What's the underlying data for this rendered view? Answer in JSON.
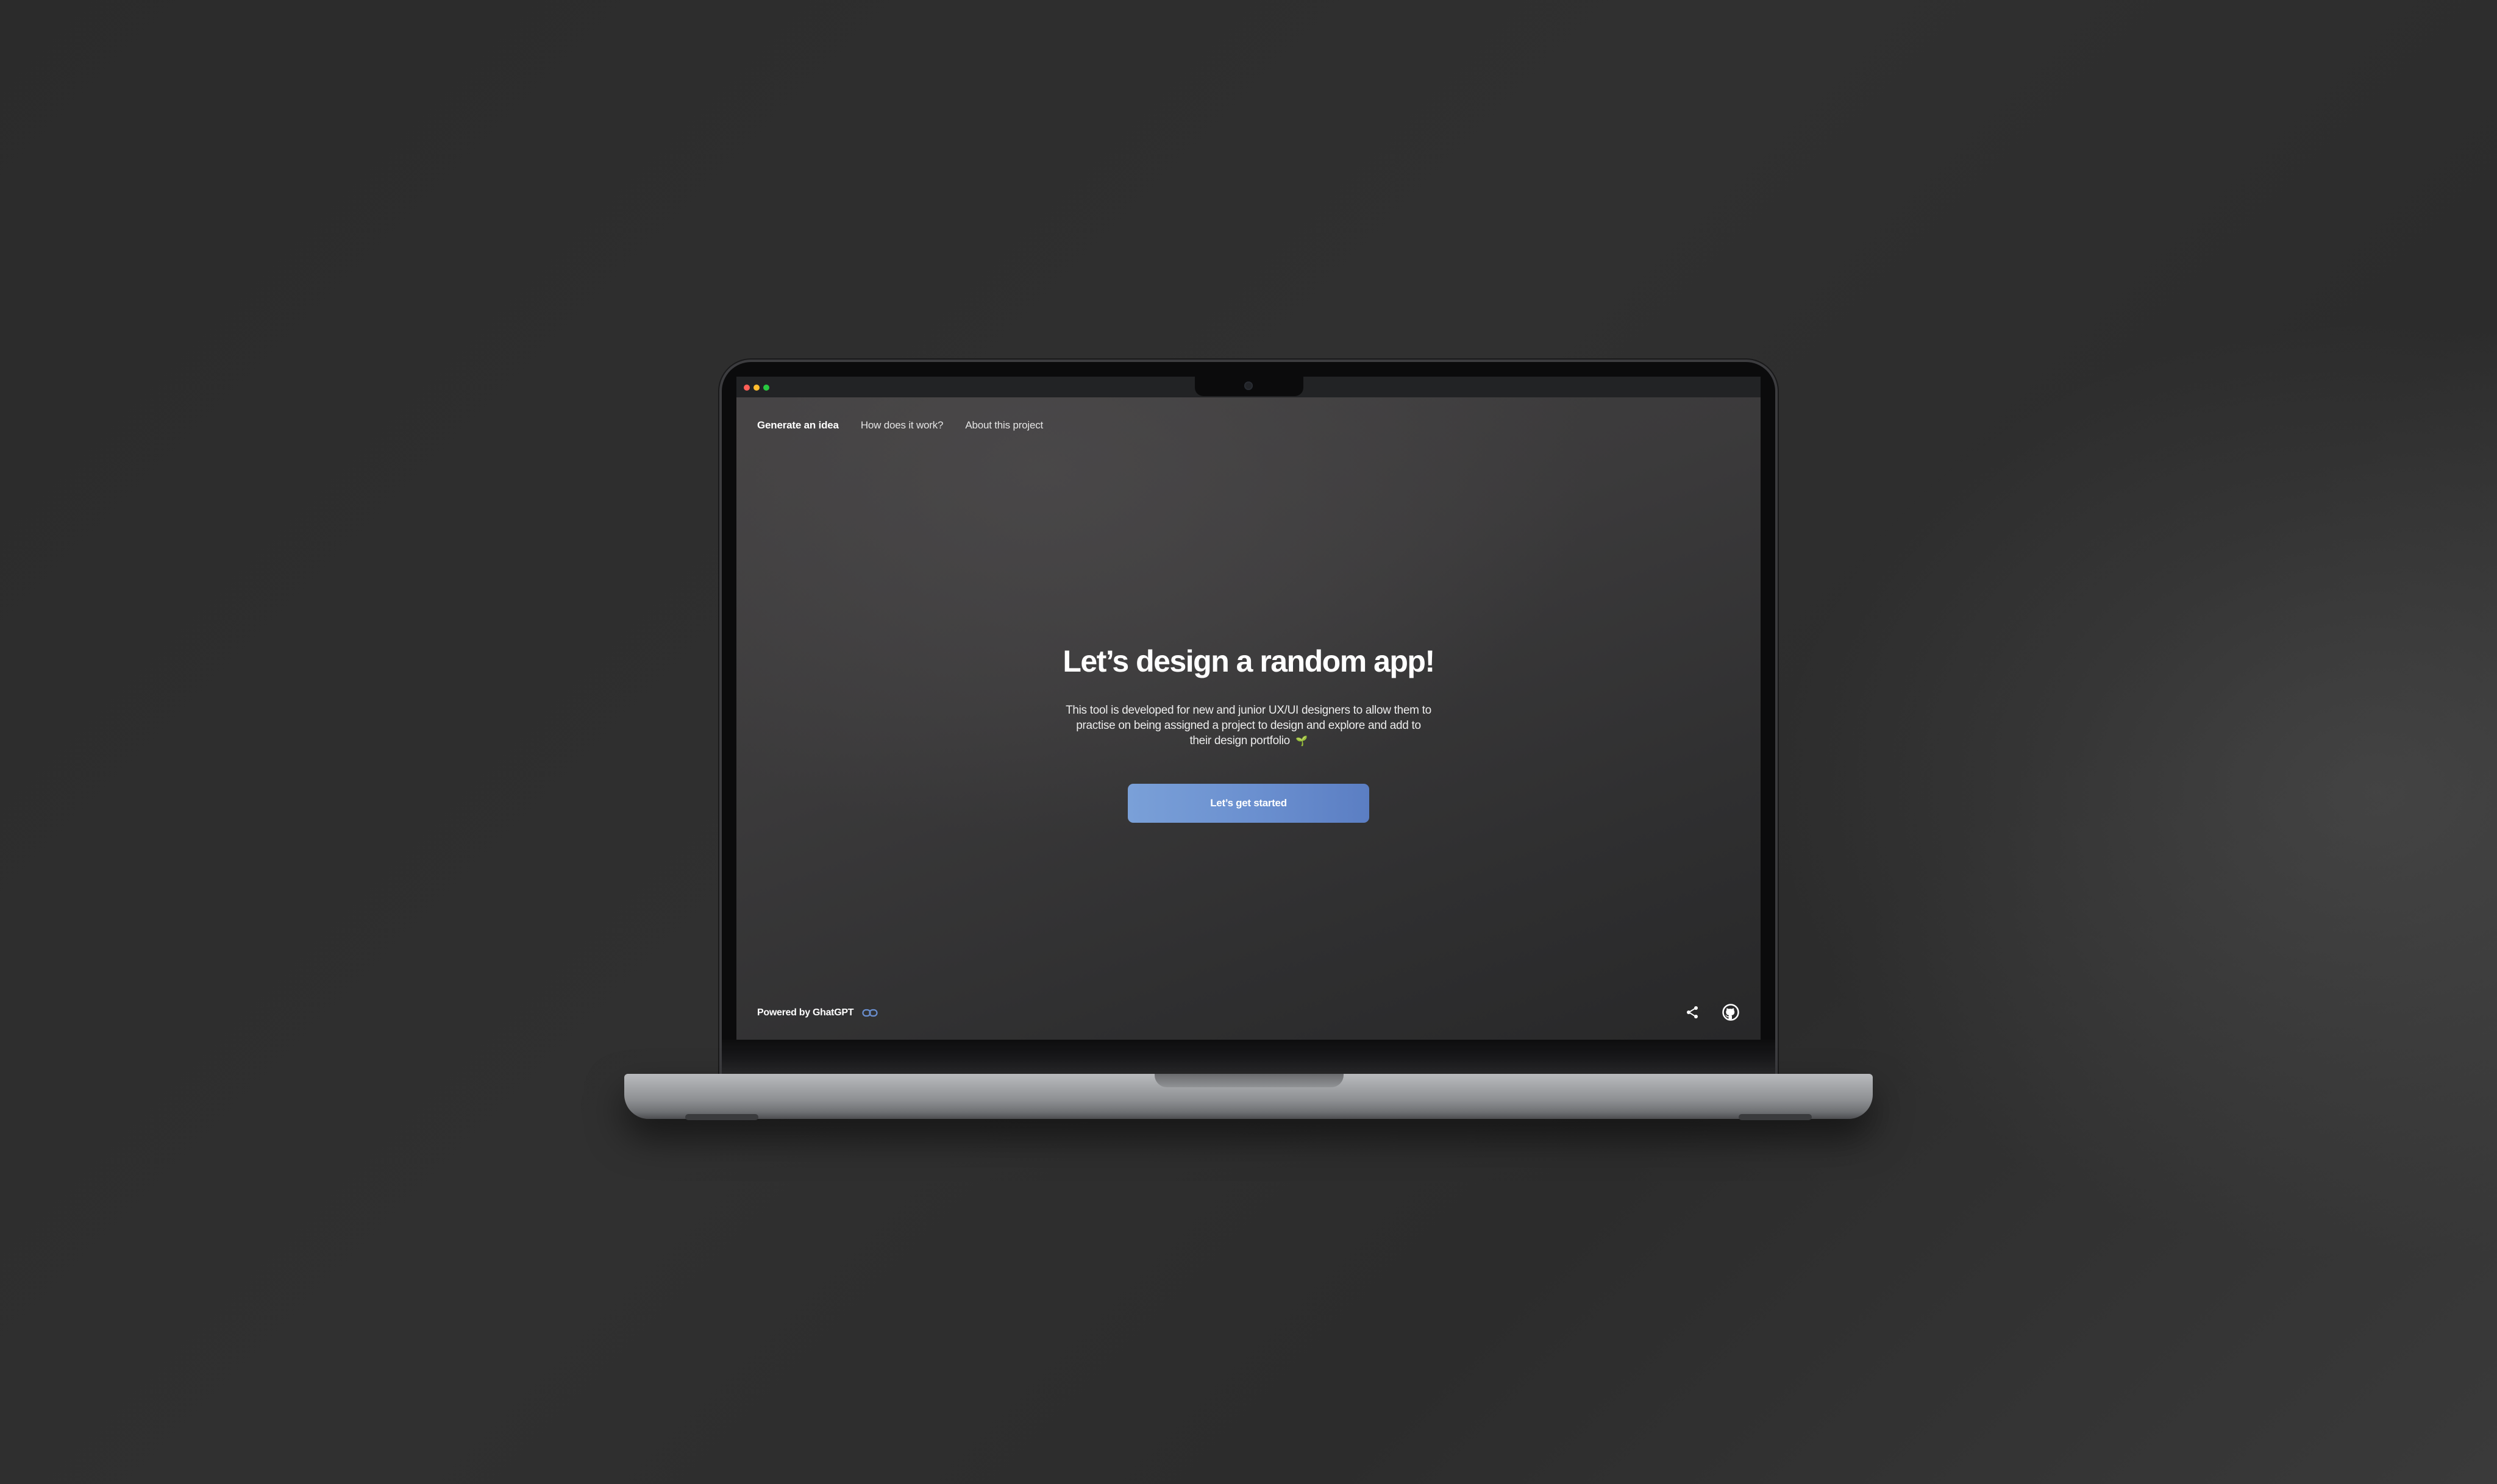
{
  "nav": {
    "items": [
      {
        "label": "Generate an idea"
      },
      {
        "label": "How does it work?"
      },
      {
        "label": "About this project"
      }
    ]
  },
  "hero": {
    "title": "Let’s design a random app!",
    "description": "This tool is developed for new and junior UX/UI designers to allow them to practise on being assigned a project to design and explore and add to their design portfolio",
    "emoji": "🌱",
    "cta_label": "Let’s get started"
  },
  "footer": {
    "powered_by": "Powered by GhatGPT",
    "icons": [
      "link-icon",
      "share-icon",
      "github-icon"
    ]
  },
  "colors": {
    "accent": "#6a8fcf",
    "screen_bg": "#3b3a3b",
    "page_bg": "#2e2e2e"
  }
}
